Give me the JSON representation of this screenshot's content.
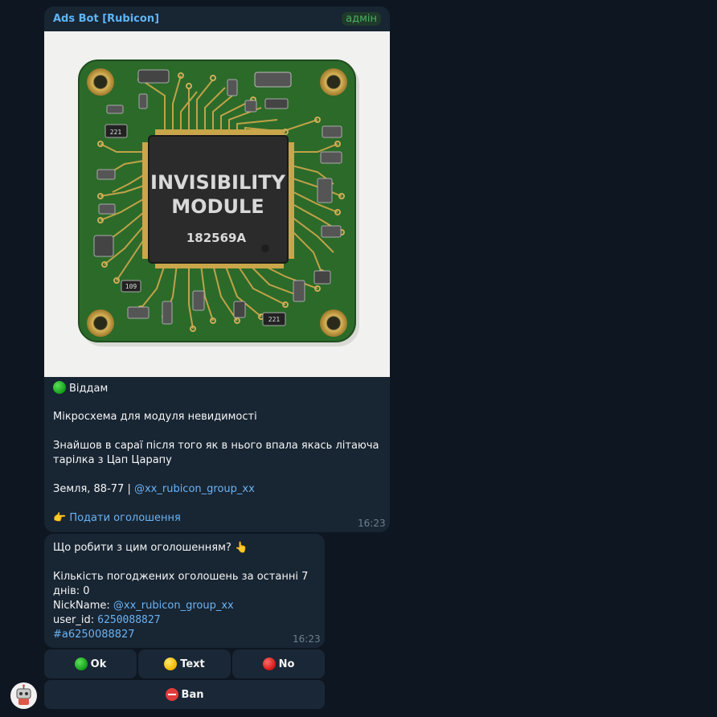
{
  "message1": {
    "sender": "Ads Bot [Rubicon]",
    "badge": "адмін",
    "chip": {
      "title_line1": "INVISIBILITY",
      "title_line2": "MODULE",
      "code": "182569A",
      "resistor_a": "221",
      "resistor_b": "109",
      "resistor_c": "221"
    },
    "status": "Віддам",
    "title": "Мікросхема для модуля невидимості",
    "desc_line1": "Знайшов в сараї після того як в нього впала якась літаюча",
    "desc_line2": "тарілка з Цап Царапу",
    "location": "Земля, 88-77 |",
    "group_link": "@xx_rubicon_group_xx",
    "cta_link": "Подати оголошення",
    "time": "16:23"
  },
  "message2": {
    "question": "Що робити з цим оголошенням? 👆",
    "count_line": "Кількість погоджених оголошень за останні 7 днів: 0",
    "nick_label": "NickName:",
    "nick_link": "@xx_rubicon_group_xx",
    "userid_label": "user_id:",
    "userid_value": "6250088827",
    "hashtag": "#a6250088827",
    "time": "16:23"
  },
  "keyboard": {
    "ok_label": "Ok",
    "text_label": "Text",
    "no_label": "No",
    "ban_label": "Ban"
  },
  "colors": {
    "background": "#0e1621",
    "bubble": "#182533",
    "link": "#6ab3f3",
    "sender": "#5eb5f7",
    "badge": "#4bb060"
  }
}
